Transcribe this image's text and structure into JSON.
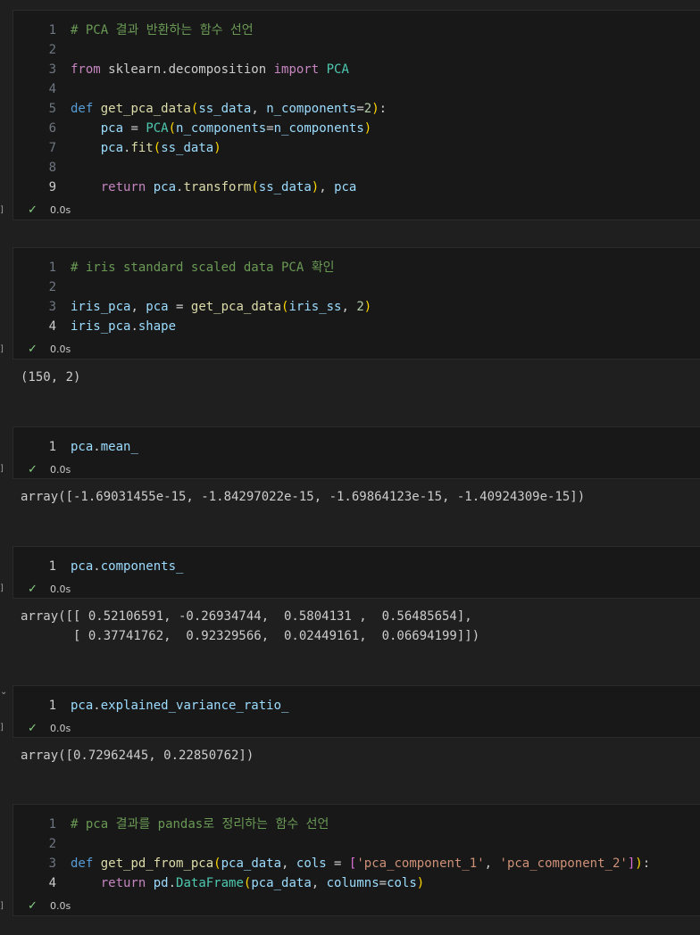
{
  "cells": [
    {
      "lines": [
        {
          "n": "1",
          "text": "# PCA 결과 반환하는 함수 선언"
        },
        {
          "n": "2",
          "text": ""
        },
        {
          "n": "3",
          "text": "from sklearn.decomposition import PCA"
        },
        {
          "n": "4",
          "text": ""
        },
        {
          "n": "5",
          "text": "def get_pca_data(ss_data, n_components=2):"
        },
        {
          "n": "6",
          "text": "    pca = PCA(n_components=n_components)"
        },
        {
          "n": "7",
          "text": "    pca.fit(ss_data)"
        },
        {
          "n": "8",
          "text": ""
        },
        {
          "n": "9",
          "text": "    return pca.transform(ss_data), pca"
        }
      ],
      "time": "0.0s"
    },
    {
      "lines": [
        {
          "n": "1",
          "text": "# iris standard scaled data PCA 확인"
        },
        {
          "n": "2",
          "text": ""
        },
        {
          "n": "3",
          "text": "iris_pca, pca = get_pca_data(iris_ss, 2)"
        },
        {
          "n": "4",
          "text": "iris_pca.shape"
        }
      ],
      "time": "0.0s",
      "output": "(150, 2)"
    },
    {
      "lines": [
        {
          "n": "1",
          "text": "pca.mean_"
        }
      ],
      "time": "0.0s",
      "output": "array([-1.69031455e-15, -1.84297022e-15, -1.69864123e-15, -1.40924309e-15])"
    },
    {
      "lines": [
        {
          "n": "1",
          "text": "pca.components_"
        }
      ],
      "time": "0.0s",
      "output": "array([[ 0.52106591, -0.26934744,  0.5804131 ,  0.56485654],\n       [ 0.37741762,  0.92329566,  0.02449161,  0.06694199]])"
    },
    {
      "lines": [
        {
          "n": "1",
          "text": "pca.explained_variance_ratio_"
        }
      ],
      "time": "0.0s",
      "output": "array([0.72962445, 0.22850762])"
    },
    {
      "lines": [
        {
          "n": "1",
          "text": "# pca 결과를 pandas로 정리하는 함수 선언"
        },
        {
          "n": "2",
          "text": ""
        },
        {
          "n": "3",
          "text": "def get_pd_from_pca(pca_data, cols = ['pca_component_1', 'pca_component_2']):"
        },
        {
          "n": "4",
          "text": "    return pd.DataFrame(pca_data, columns=cols)"
        }
      ],
      "time": "0.0s"
    }
  ],
  "icons": {
    "check": "check-icon",
    "collapse": "chevron-down-icon"
  },
  "colors": {
    "success": "#89d185",
    "keyword": "#569cd6",
    "function": "#dcdcaa",
    "comment": "#6a9955"
  }
}
